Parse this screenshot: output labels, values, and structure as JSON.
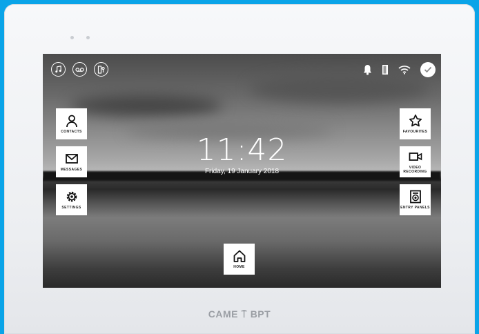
{
  "clock": {
    "time": "11:42",
    "date": "Friday, 19 January 2018"
  },
  "tiles": {
    "contacts": "CONTACTS",
    "messages": "MESSAGES",
    "settings": "SETTINGS",
    "favourites": "FAVOURITES",
    "video_recording": "VIDEO RECORDING",
    "entry_panels": "ENTRY PANELS",
    "home": "HOME"
  },
  "brand": "CAME ⍑ BPT",
  "status_icons": {
    "left": [
      "music-note-icon",
      "voicemail-icon",
      "door-key-icon"
    ],
    "right": [
      "bell-icon",
      "door-icon",
      "wifi-icon",
      "check-icon"
    ]
  },
  "colors": {
    "background": "#0aa4e8",
    "device": "#f2f3f5",
    "tile": "#ffffff"
  }
}
